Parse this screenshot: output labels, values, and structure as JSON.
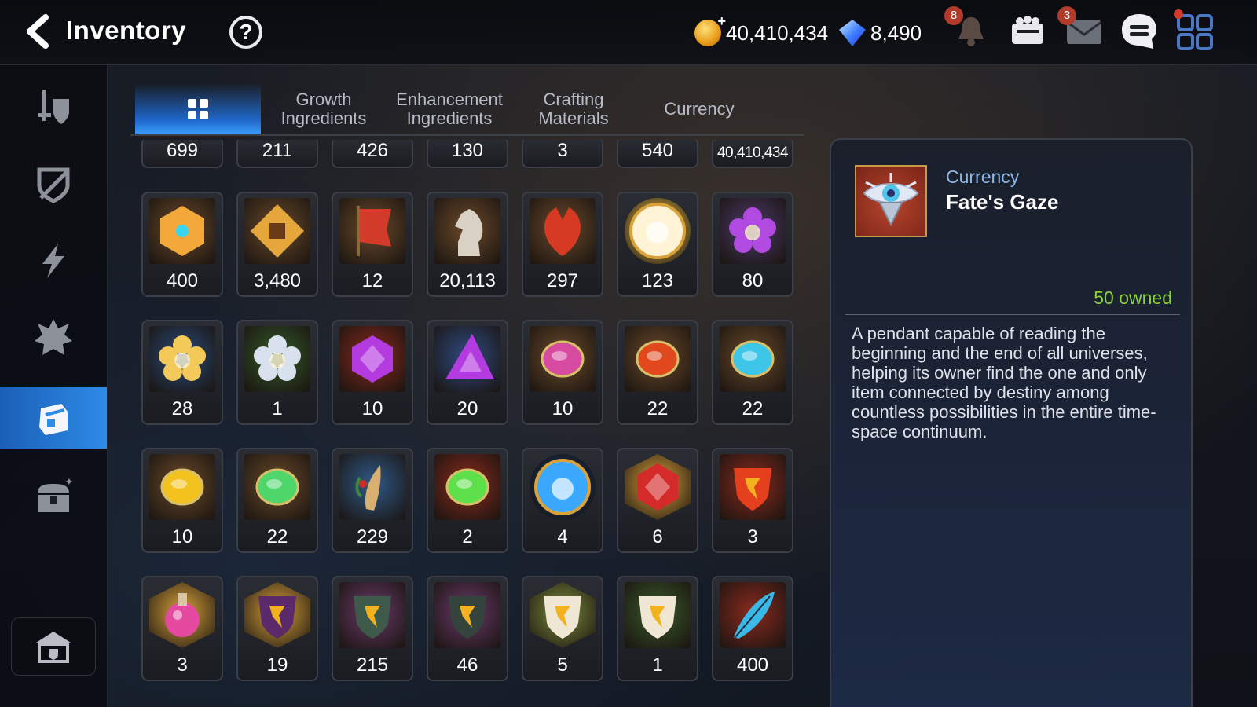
{
  "header": {
    "title": "Inventory",
    "help_label": "?",
    "gold": "40,410,434",
    "crystals": "8,490",
    "plus_sign": "+",
    "notifications_badge": "8",
    "mail_badge": "3"
  },
  "tabs": [
    {
      "label": "",
      "icon": "grid-icon",
      "active": true
    },
    {
      "label": "Growth\nIngredients"
    },
    {
      "label": "Enhancement\nIngredients"
    },
    {
      "label": "Crafting\nMaterials"
    },
    {
      "label": "Currency"
    }
  ],
  "sidebar": {
    "items": [
      "equipment-icon",
      "artifact-icon",
      "catalyst-icon",
      "rune-icon",
      "inventory-bag-icon",
      "chest-icon"
    ],
    "active_index": 4,
    "bottom": "guild-icon"
  },
  "items_partial_row": [
    "699",
    "211",
    "426",
    "130",
    "3",
    "540",
    "40,410,434"
  ],
  "items": [
    {
      "qty": "400",
      "icon": "gold-shield-emblem-icon"
    },
    {
      "qty": "3,480",
      "icon": "fist-emblem-icon"
    },
    {
      "qty": "12",
      "icon": "war-banner-icon"
    },
    {
      "qty": "20,113",
      "icon": "chess-knight-icon"
    },
    {
      "qty": "297",
      "icon": "red-leaf-icon"
    },
    {
      "qty": "123",
      "icon": "cat-face-coin-icon"
    },
    {
      "qty": "80",
      "icon": "purple-flower-crystal-icon"
    },
    {
      "qty": "28",
      "icon": "golden-flower-icon"
    },
    {
      "qty": "1",
      "icon": "silver-flower-icon"
    },
    {
      "qty": "10",
      "icon": "purple-hex-gem-icon"
    },
    {
      "qty": "20",
      "icon": "purple-triangle-gem-icon"
    },
    {
      "qty": "10",
      "icon": "pink-oval-gem-icon"
    },
    {
      "qty": "22",
      "icon": "red-oval-gem-icon"
    },
    {
      "qty": "22",
      "icon": "blue-oval-gem-icon"
    },
    {
      "qty": "10",
      "icon": "yellow-oval-gem-icon"
    },
    {
      "qty": "22",
      "icon": "green-oval-gem-icon"
    },
    {
      "qty": "229",
      "icon": "herb-root-icon"
    },
    {
      "qty": "2",
      "icon": "green-orb-icon"
    },
    {
      "qty": "4",
      "icon": "blue-rune-orb-icon"
    },
    {
      "qty": "6",
      "icon": "red-star-crystal-icon"
    },
    {
      "qty": "3",
      "icon": "red-hammer-crystal-icon"
    },
    {
      "qty": "3",
      "icon": "pink-potion-icon"
    },
    {
      "qty": "19",
      "icon": "purple-star-stone-icon"
    },
    {
      "qty": "215",
      "icon": "gold-hammer-stone-icon"
    },
    {
      "qty": "46",
      "icon": "lightning-stone-icon"
    },
    {
      "qty": "5",
      "icon": "white-star-stone-icon"
    },
    {
      "qty": "1",
      "icon": "white-hammer-stone-icon"
    },
    {
      "qty": "400",
      "icon": "blue-feather-crystal-icon"
    }
  ],
  "detail": {
    "category": "Currency",
    "name": "Fate's Gaze",
    "owned": "50 owned",
    "description": "A pendant capable of reading the beginning and the end of all universes, helping its owner find the one and only item connected by destiny among countless possibilities in the entire time-space continuum."
  },
  "colors": {
    "accent": "#2e8be6",
    "owned": "#8bd23e",
    "category": "#8fb7e6"
  }
}
